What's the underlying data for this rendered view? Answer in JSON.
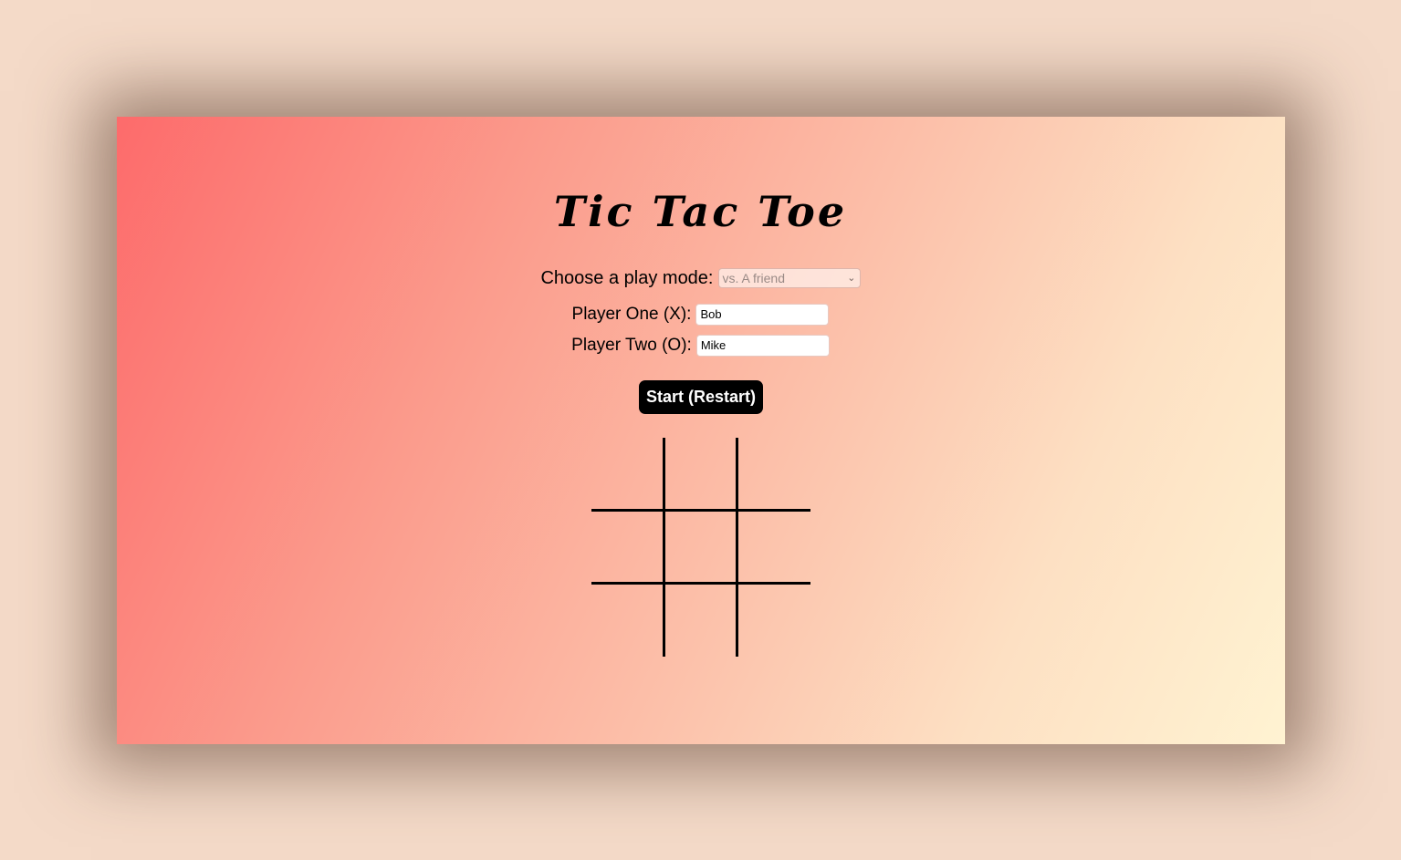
{
  "title": "Tic Tac Toe",
  "play_mode": {
    "label": "Choose a play mode:",
    "selected": "vs. A friend"
  },
  "players": {
    "one_label": "Player One (X):",
    "one_value": "Bob",
    "two_label": "Player Two (O):",
    "two_value": "Mike"
  },
  "start_button": "Start (Restart)",
  "board": {
    "cells": [
      "",
      "",
      "",
      "",
      "",
      "",
      "",
      "",
      ""
    ]
  }
}
